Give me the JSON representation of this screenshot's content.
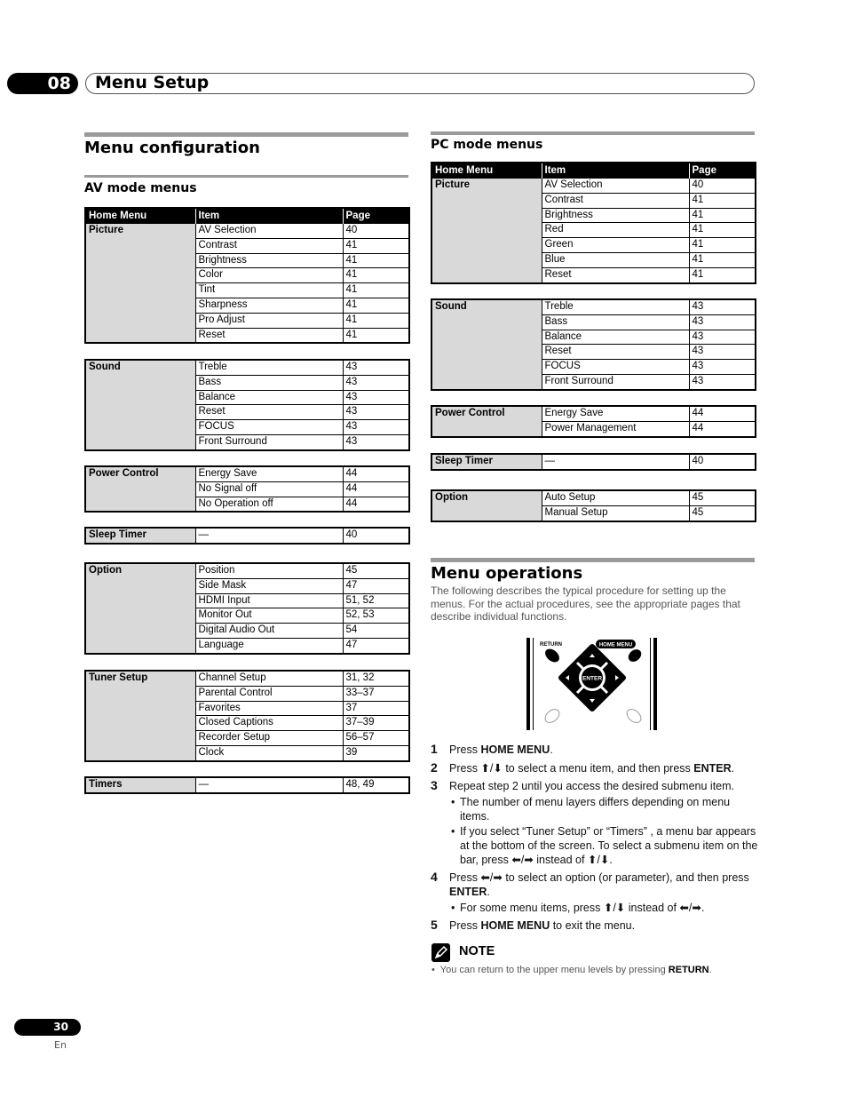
{
  "chapter": {
    "number": "08",
    "title": "Menu Setup"
  },
  "config_section": {
    "title": "Menu configuration",
    "av": {
      "title": "AV mode menus",
      "headers": [
        "Home Menu",
        "Item",
        "Page"
      ],
      "groups": [
        {
          "menu": "Picture",
          "rows": [
            [
              "AV Selection",
              "40"
            ],
            [
              "Contrast",
              "41"
            ],
            [
              "Brightness",
              "41"
            ],
            [
              "Color",
              "41"
            ],
            [
              "Tint",
              "41"
            ],
            [
              "Sharpness",
              "41"
            ],
            [
              "Pro Adjust",
              "41"
            ],
            [
              "Reset",
              "41"
            ]
          ]
        },
        {
          "menu": "Sound",
          "rows": [
            [
              "Treble",
              "43"
            ],
            [
              "Bass",
              "43"
            ],
            [
              "Balance",
              "43"
            ],
            [
              "Reset",
              "43"
            ],
            [
              "FOCUS",
              "43"
            ],
            [
              "Front Surround",
              "43"
            ]
          ]
        },
        {
          "menu": "Power Control",
          "rows": [
            [
              "Energy Save",
              "44"
            ],
            [
              "No Signal off",
              "44"
            ],
            [
              "No Operation off",
              "44"
            ]
          ]
        },
        {
          "menu": "Sleep Timer",
          "rows": [
            [
              "—",
              "40"
            ]
          ]
        },
        {
          "menu": "Option",
          "rows": [
            [
              "Position",
              "45"
            ],
            [
              "Side Mask",
              "47"
            ],
            [
              "HDMI Input",
              "51, 52"
            ],
            [
              "Monitor Out",
              "52, 53"
            ],
            [
              "Digital Audio Out",
              "54"
            ],
            [
              "Language",
              "47"
            ]
          ]
        },
        {
          "menu": "Tuner Setup",
          "rows": [
            [
              "Channel Setup",
              "31, 32"
            ],
            [
              "Parental Control",
              "33–37"
            ],
            [
              "Favorites",
              "37"
            ],
            [
              "Closed Captions",
              "37–39"
            ],
            [
              "Recorder Setup",
              "56–57"
            ],
            [
              "Clock",
              "39"
            ]
          ]
        },
        {
          "menu": "Timers",
          "rows": [
            [
              "—",
              "48, 49"
            ]
          ]
        }
      ]
    },
    "pc": {
      "title": "PC mode menus",
      "headers": [
        "Home Menu",
        "Item",
        "Page"
      ],
      "groups": [
        {
          "menu": "Picture",
          "rows": [
            [
              "AV Selection",
              "40"
            ],
            [
              "Contrast",
              "41"
            ],
            [
              "Brightness",
              "41"
            ],
            [
              "Red",
              "41"
            ],
            [
              "Green",
              "41"
            ],
            [
              "Blue",
              "41"
            ],
            [
              "Reset",
              "41"
            ]
          ]
        },
        {
          "menu": "Sound",
          "rows": [
            [
              "Treble",
              "43"
            ],
            [
              "Bass",
              "43"
            ],
            [
              "Balance",
              "43"
            ],
            [
              "Reset",
              "43"
            ],
            [
              "FOCUS",
              "43"
            ],
            [
              "Front Surround",
              "43"
            ]
          ]
        },
        {
          "menu": "Power Control",
          "rows": [
            [
              "Energy Save",
              "44"
            ],
            [
              "Power Management",
              "44"
            ]
          ]
        },
        {
          "menu": "Sleep Timer",
          "rows": [
            [
              "—",
              "40"
            ]
          ]
        },
        {
          "menu": "Option",
          "rows": [
            [
              "Auto Setup",
              "45"
            ],
            [
              "Manual Setup",
              "45"
            ]
          ]
        }
      ]
    }
  },
  "operations": {
    "title": "Menu operations",
    "intro": "The following describes the typical procedure for setting up the menus. For the actual procedures, see the appropriate pages that describe individual functions.",
    "remote": {
      "return_label": "RETURN",
      "home_menu_label": "HOME MENU",
      "enter_label": "ENTER"
    },
    "steps": [
      {
        "num": "1",
        "html": "Press <b>HOME MENU</b>."
      },
      {
        "num": "2",
        "html": "Press ⬆/⬇ to select a menu item, and then press <b>ENTER</b>."
      },
      {
        "num": "3",
        "html": "Repeat step 2 until you access the desired submenu item.",
        "bullets": [
          "The number of menu layers differs depending on menu items.",
          "If you select “Tuner Setup” or “Timers” , a menu bar appears at the bottom of the screen. To select a submenu item on the bar, press ⬅/➡ instead of ⬆/⬇."
        ]
      },
      {
        "num": "4",
        "html": "Press ⬅/➡ to select an option (or parameter), and then press <b>ENTER</b>.",
        "bullets": [
          "For some menu items, press ⬆/⬇ instead of ⬅/➡."
        ]
      },
      {
        "num": "5",
        "html": "Press <b>HOME MENU</b> to exit the menu."
      }
    ],
    "note": {
      "label": "NOTE",
      "text_prefix": "You can return to the upper menu levels by pressing ",
      "text_bold": "RETURN",
      "text_suffix": "."
    }
  },
  "footer": {
    "page": "30",
    "lang": "En"
  }
}
